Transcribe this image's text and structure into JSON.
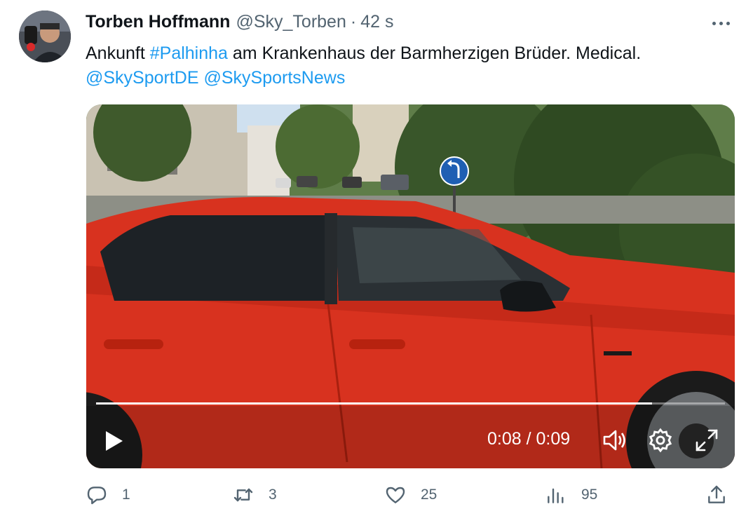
{
  "tweet": {
    "author_name": "Torben Hoffmann",
    "author_handle": "@Sky_Torben",
    "separator": "·",
    "time": "42 s",
    "text_before": "Ankunft ",
    "hashtag": "#Palhinha",
    "text_after": " am Krankenhaus der Barmherzigen Brüder. Medical.",
    "mention_1": "@SkySportDE",
    "mention_2": "@SkySportsNews"
  },
  "video": {
    "timecode": "0:08 / 0:09",
    "progress": 0.884
  },
  "actions": {
    "replies": "1",
    "retweets": "3",
    "likes": "25",
    "views": "95"
  },
  "icons": [
    "more-icon",
    "play-icon",
    "volume-icon",
    "settings-icon",
    "fullscreen-icon",
    "reply-icon",
    "retweet-icon",
    "like-icon",
    "views-icon",
    "share-icon"
  ],
  "colors": {
    "link": "#1d9bf0",
    "secondary_text": "#536471",
    "primary_text": "#0f1419",
    "car": "#d8321f"
  }
}
